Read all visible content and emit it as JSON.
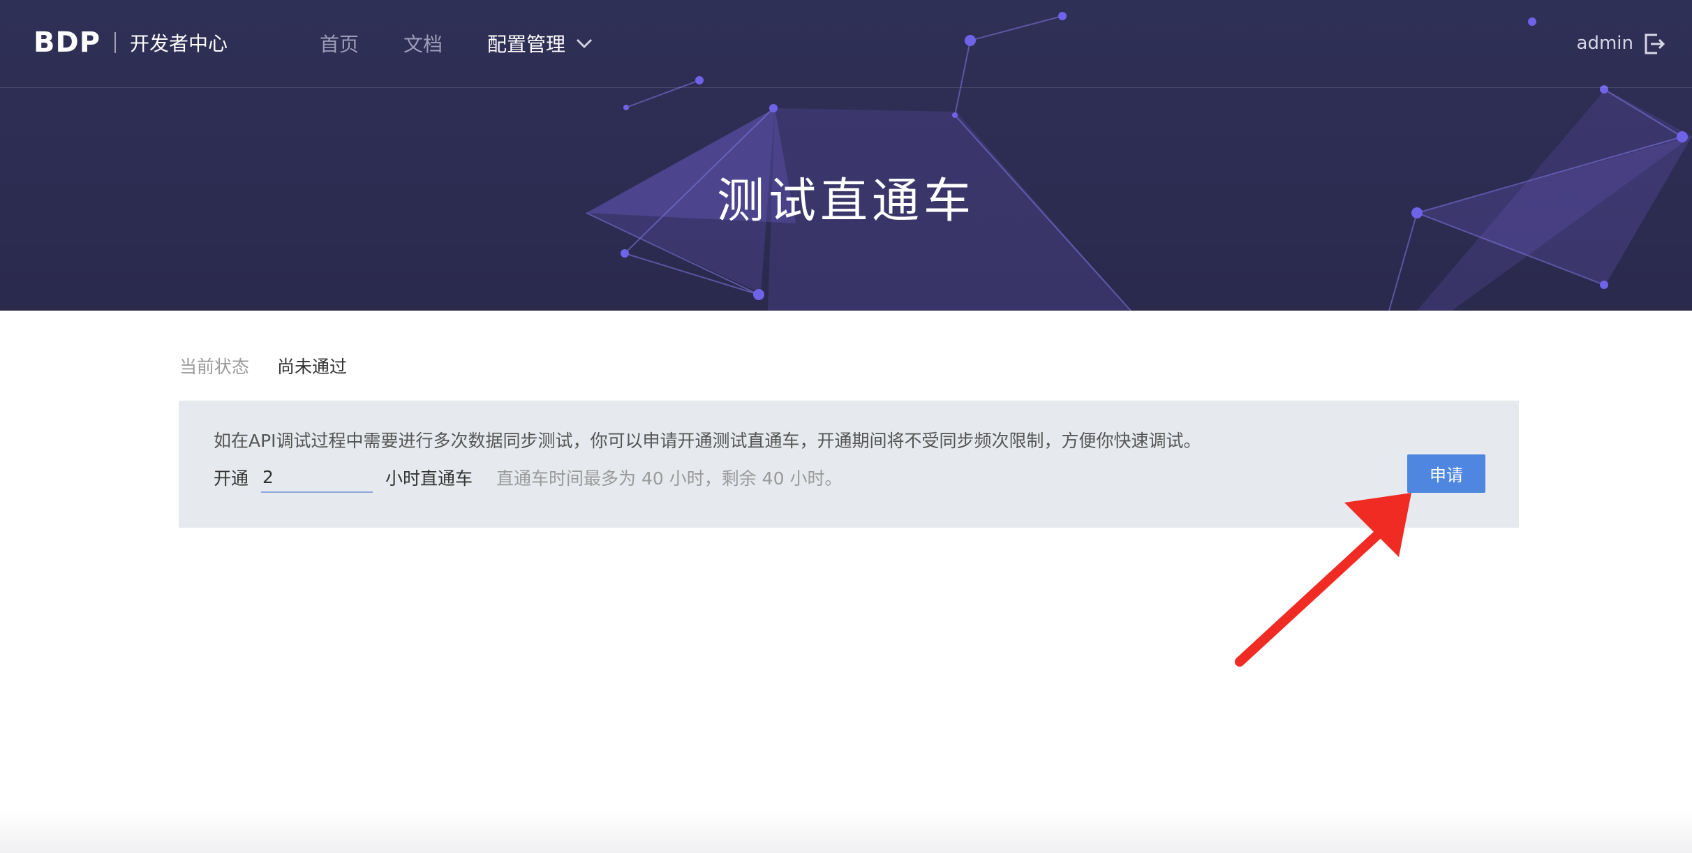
{
  "brand": {
    "logo": "BDP",
    "subtitle": "开发者中心"
  },
  "nav": {
    "items": [
      {
        "label": "首页"
      },
      {
        "label": "文档"
      },
      {
        "label": "配置管理"
      }
    ]
  },
  "user": {
    "name": "admin"
  },
  "hero": {
    "title": "测试直通车"
  },
  "status": {
    "label": "当前状态",
    "value": "尚未通过"
  },
  "panel": {
    "description": "如在API调试过程中需要进行多次数据同步测试，你可以申请开通测试直通车，开通期间将不受同步频次限制，方便你快速调试。",
    "open_label": "开通",
    "hours_value": "2",
    "hours_suffix": "小时直通车",
    "hint": "直通车时间最多为 40 小时，剩余 40 小时。",
    "apply_label": "申请"
  },
  "colors": {
    "hero_bg": "#2d2c52",
    "accent": "#4f87e0",
    "arrow": "#f02b24",
    "panel_bg": "#e6e9ed"
  },
  "icons": {
    "dropdown": "chevron-down-icon",
    "logout": "logout-icon",
    "annotation": "red-arrow-icon"
  }
}
